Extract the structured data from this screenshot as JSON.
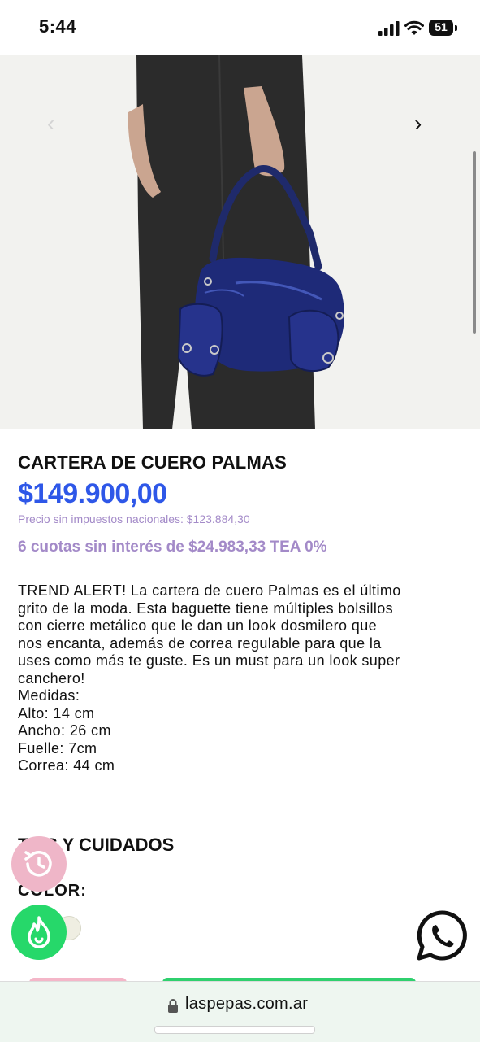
{
  "status_bar": {
    "time": "5:44",
    "battery": "51"
  },
  "carousel": {
    "prev_icon": "chevron-left-icon",
    "next_icon": "chevron-right-icon",
    "prev_glyph": "‹",
    "next_glyph": "›"
  },
  "product": {
    "title": "CARTERA DE CUERO PALMAS",
    "price": "$149.900,00",
    "price_without_tax": "Precio sin impuestos nacionales: $123.884,30",
    "installments": "6 cuotas sin interés de $24.983,33 TEA 0%",
    "description_lines": [
      "TREND ALERT! La cartera de cuero Palmas es el último",
      "grito de la moda. Esta baguette tiene múltiples bolsillos",
      "con cierre metálico que le dan un look dosmilero que",
      "nos encanta, además de correa regulable para que la",
      "uses como más te guste. Es un must para un look super",
      "canchero!",
      "Medidas:",
      "Alto: 14 cm",
      "Ancho: 26 cm",
      "Fuelle: 7cm",
      "Correa: 44 cm"
    ]
  },
  "tips": {
    "title": "TIPS Y CUIDADOS"
  },
  "color": {
    "label": "COLOR:",
    "swatch_color": "#efeee2"
  },
  "fabs": {
    "history_icon": "history-icon",
    "hot_icon": "flame-icon",
    "whatsapp_icon": "whatsapp-icon"
  },
  "url_bar": {
    "url": "laspepas.com.ar"
  },
  "colors": {
    "price_blue": "#2e57e8",
    "lilac": "#a38ac8",
    "green": "#26d86a",
    "pink": "#efb6c8"
  }
}
